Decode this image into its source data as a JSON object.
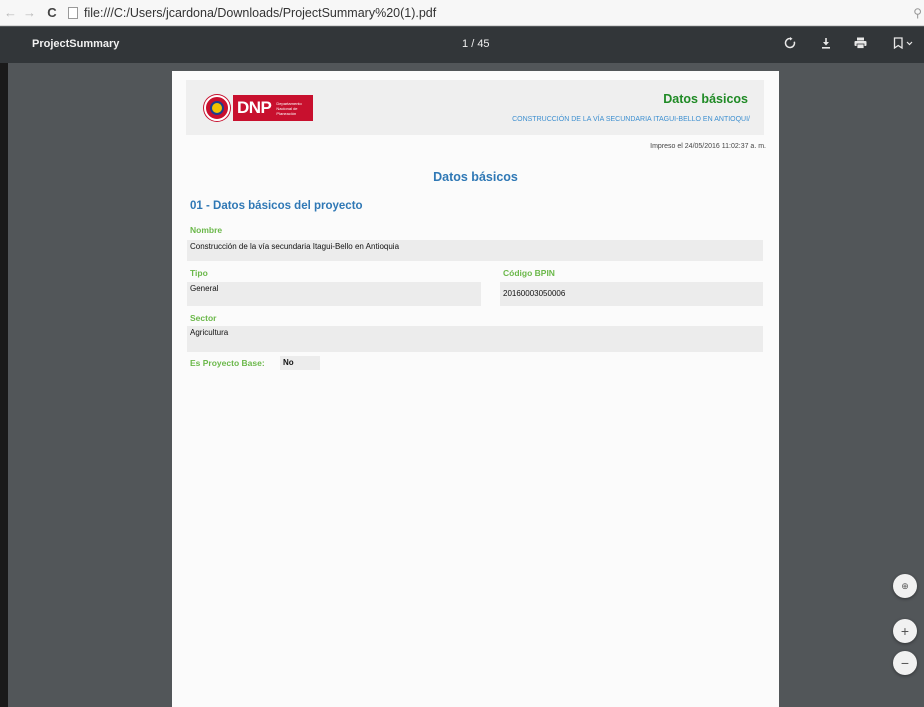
{
  "browser": {
    "url": "file:///C:/Users/jcardona/Downloads/ProjectSummary%20(1).pdf",
    "back_icon": "back-arrow-icon",
    "forward_icon": "forward-arrow-icon",
    "reload_icon": "reload-icon"
  },
  "toolbar": {
    "doc_title": "ProjectSummary",
    "page_current": "1",
    "page_separator": "/",
    "page_total": "45",
    "icons": [
      "rotate-icon",
      "download-icon",
      "print-icon",
      "bookmark-icon"
    ]
  },
  "page": {
    "header_title": "Datos básicos",
    "header_subtitle": "CONSTRUCCIÓN DE LA VÍA SECUNDARIA ITAGUI-BELLO EN  ANTIOQUI/",
    "printed": "Impreso el 24/05/2016 11:02:37 a. m.",
    "logo_text": "DNP",
    "logo_subtext": "Departamento Nacional de Planeación",
    "section_title": "Datos básicos",
    "subsection_title": "01 - Datos básicos del proyecto",
    "fields": {
      "nombre_label": "Nombre",
      "nombre_value": "Construcción de la vía secundaria Itagui-Bello en  Antioquia",
      "tipo_label": "Tipo",
      "tipo_value": "General",
      "bpin_label": "Código BPIN",
      "bpin_value": "20160003050006",
      "sector_label": "Sector",
      "sector_value": "Agricultura",
      "base_label": "Es Proyecto Base:",
      "base_value": "No"
    }
  },
  "zoom": {
    "fit_icon": "fit-page-icon",
    "zoom_in_label": "+",
    "zoom_out_label": "−"
  },
  "colors": {
    "toolbar_bg": "#323639",
    "viewer_bg": "#525659",
    "green_title": "#1f8a25",
    "blue_heading": "#2f78b5",
    "label_green": "#6bb84a"
  }
}
